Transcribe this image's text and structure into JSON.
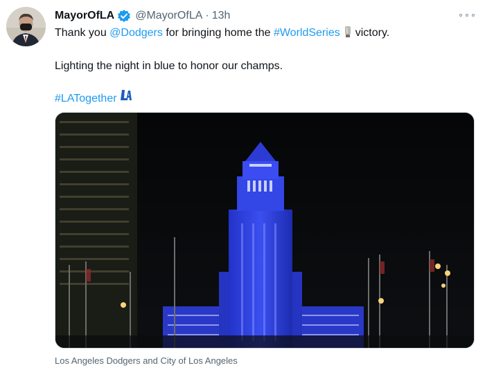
{
  "tweet": {
    "display_name": "MayorOfLA",
    "handle": "@MayorOfLA",
    "separator": "·",
    "timestamp": "13h",
    "verified": true,
    "line1": {
      "before": "Thank you ",
      "mention": "@Dodgers",
      "middle": " for bringing home the ",
      "hashtag": "#WorldSeries",
      "trophy_icon": "trophy-icon",
      "after": "victory."
    },
    "line2": "Lighting the night in blue to honor our champs.",
    "line3": {
      "hashtag": "#LATogether",
      "logo_icon": "dodgers-la-logo-icon"
    }
  },
  "media": {
    "caption": "Los Angeles Dodgers and City of Los Angeles",
    "description_icon": "city-hall-photo"
  },
  "colors": {
    "link": "#1d9bf0",
    "text": "#0f1419",
    "secondary": "#536471",
    "building_blue": "#2a3dd6"
  }
}
